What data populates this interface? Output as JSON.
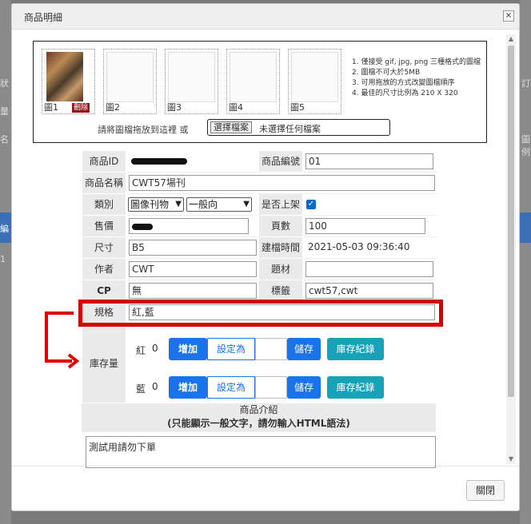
{
  "background": {
    "frag_status": "狀",
    "frag_qty": "量",
    "frag_name": "名",
    "frag_code": "編",
    "frag_one": "1",
    "frag_right1": "訂",
    "frag_right2": "圖例",
    "accent": "#3b6fb6"
  },
  "modal": {
    "title": "商品明細",
    "close_glyph": "×",
    "footer_close": "關閉"
  },
  "upload": {
    "slots": [
      {
        "label": "圖1",
        "delete": "刪除"
      },
      {
        "label": "圖2"
      },
      {
        "label": "圖3"
      },
      {
        "label": "圖4"
      },
      {
        "label": "圖5"
      }
    ],
    "rules": [
      "1. 僅接受 gif, jpg, png 三種格式的圖檔",
      "2. 圖檔不可大於5MB",
      "3. 可用拖放的方式改變圖檔順序",
      "4. 最佳的尺寸比例為 210 X 320"
    ],
    "drag_hint": "請將圖檔拖放到這裡 或",
    "choose_file": "選擇檔案",
    "file_status": "未選擇任何檔案"
  },
  "form": {
    "product_id_label": "商品ID",
    "product_code_label": "商品編號",
    "product_code": "01",
    "product_name_label": "商品名稱",
    "product_name": "CWT57場刊",
    "category_label": "類別",
    "category_1": "圖像刊物",
    "category_2": "一般向",
    "listed_label": "是否上架",
    "listed_check": "✓",
    "price_label": "售價",
    "pages_label": "頁數",
    "pages": "100",
    "size_label": "尺寸",
    "size": "B5",
    "created_label": "建檔時間",
    "created": "2021-05-03 09:36:40",
    "author_label": "作者",
    "author": "CWT",
    "subject_label": "題材",
    "subject": "",
    "cp_label": "CP",
    "cp": "無",
    "tags_label": "標籤",
    "tags": "cwt57,cwt",
    "spec_label": "規格",
    "spec": "紅,藍",
    "stock_label": "庫存量",
    "stock": [
      {
        "name": "紅",
        "qty": "0",
        "add": "增加",
        "set": "設定為",
        "save": "儲存",
        "log": "庫存紀錄"
      },
      {
        "name": "藍",
        "qty": "0",
        "add": "增加",
        "set": "設定為",
        "save": "儲存",
        "log": "庫存紀錄"
      }
    ],
    "intro_title": "商品介紹",
    "intro_note": "(只能顯示一般文字，請勿輸入HTML語法)",
    "intro_text": "測試用請勿下單"
  },
  "colors": {
    "primary": "#1a73e8",
    "teal": "#17a2b8",
    "highlight": "#d40000"
  }
}
